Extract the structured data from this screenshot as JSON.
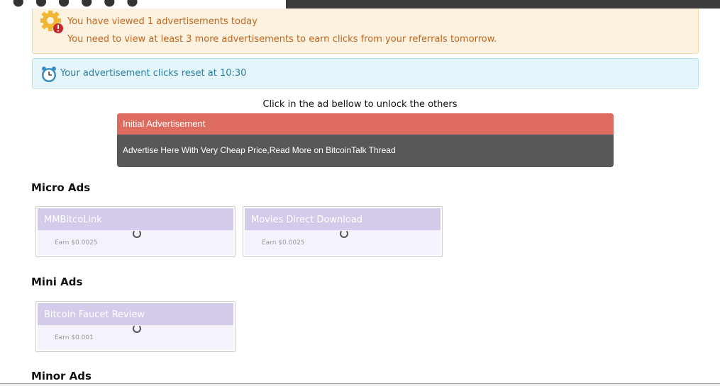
{
  "alerts": {
    "views_line": "You have viewed 1 advertisements today",
    "requirement_line": "You need to view at least 3 more advertisements to earn clicks from your referrals tomorrow.",
    "reset_line": "Your advertisement clicks reset at 10:30"
  },
  "unlock_text": "Click in the ad bellow to unlock the others",
  "initial_ad": {
    "title": "Initial Advertisement",
    "body": "Advertise Here With Very Cheap Price,Read More on BitcoinTalk Thread"
  },
  "sections": {
    "micro": "Micro Ads",
    "mini": "Mini Ads",
    "minor": "Minor Ads"
  },
  "micro_ads": [
    {
      "title": "MMBitcoLink",
      "earn": "Earn $0.0025"
    },
    {
      "title": "Movies Direct Download",
      "earn": "Earn $0.0025"
    }
  ],
  "mini_ads": [
    {
      "title": "Bitcoin Faucet Review",
      "earn": "Earn $0.001"
    }
  ],
  "colors": {
    "warn_bg": "#fdf2df",
    "warn_text": "#c0651e",
    "info_bg": "#e4f6fb",
    "info_text": "#2a7fa0",
    "initial_head": "#de6b5f",
    "initial_body": "#58585a",
    "ad_title_bar": "#d4cbeb"
  }
}
